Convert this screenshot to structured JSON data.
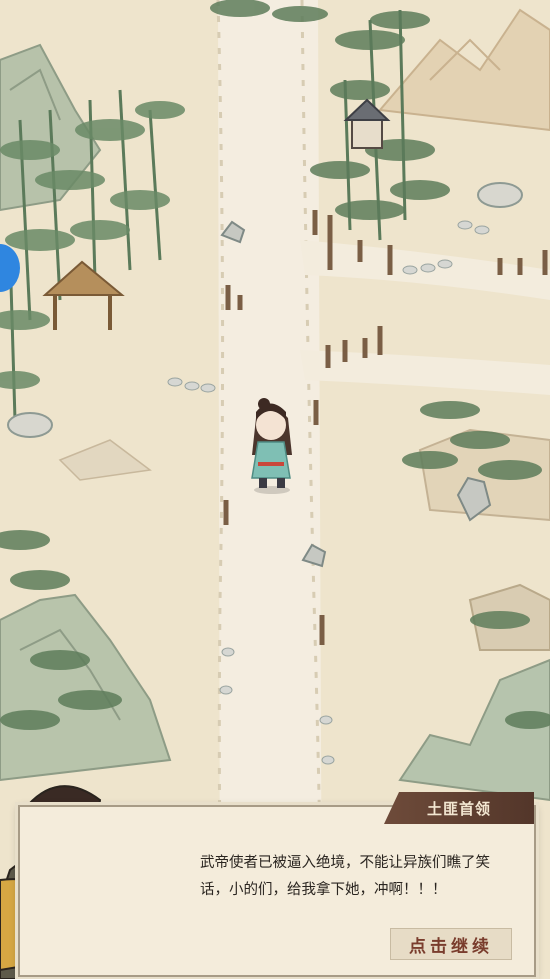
{
  "game": {
    "speaker_name": "土匪首领",
    "dialog_text": "武帝使者已被逼入绝境，不能让异族们瞧了笑话，小的们，给我拿下她，冲啊！！！",
    "continue_label": "点击继续"
  },
  "colors": {
    "parchment": "#efe6d1",
    "path": "#f3ecd9",
    "bamboo": "#5b7a5a",
    "mountain": "#a9b8a2",
    "speaker_tag": "#6e4b3a",
    "continue_text": "#7a3d2d",
    "side_indicator": "#2f86e0"
  }
}
